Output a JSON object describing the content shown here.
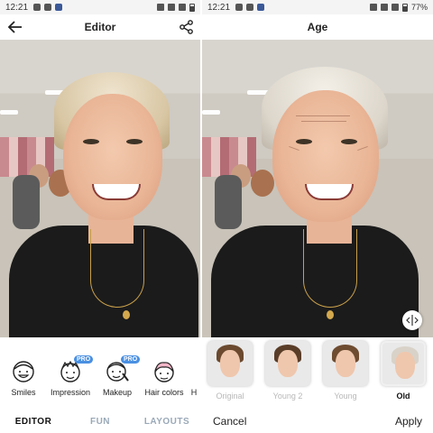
{
  "left": {
    "status": {
      "time": "12:21"
    },
    "header": {
      "title": "Editor"
    },
    "tools": [
      {
        "label": "Smiles",
        "icon": "smile-face-icon",
        "pro": false
      },
      {
        "label": "Impression",
        "icon": "impression-face-icon",
        "pro": true
      },
      {
        "label": "Makeup",
        "icon": "makeup-face-icon",
        "pro": true
      },
      {
        "label": "Hair colors",
        "icon": "hair-colors-icon",
        "pro": false
      },
      {
        "label": "H",
        "icon": "",
        "pro": false
      }
    ],
    "pro_label": "PRO",
    "nav": [
      {
        "label": "EDITOR",
        "active": true
      },
      {
        "label": "FUN",
        "active": false
      },
      {
        "label": "LAYOUTS",
        "active": false
      }
    ]
  },
  "right": {
    "status": {
      "time": "12:21",
      "battery": "77%"
    },
    "header": {
      "title": "Age"
    },
    "ages": [
      {
        "label": "Original",
        "selected": false,
        "hair": "#6b4a2f"
      },
      {
        "label": "Young 2",
        "selected": false,
        "hair": "#5a3d28"
      },
      {
        "label": "Young",
        "selected": false,
        "hair": "#6e4c30"
      },
      {
        "label": "Old",
        "selected": true,
        "hair": "#d8d2c8"
      }
    ],
    "actions": {
      "cancel": "Cancel",
      "apply": "Apply"
    }
  },
  "colors": {
    "accent": "#4a90e2",
    "nav_inactive": "#9aa9b8"
  }
}
